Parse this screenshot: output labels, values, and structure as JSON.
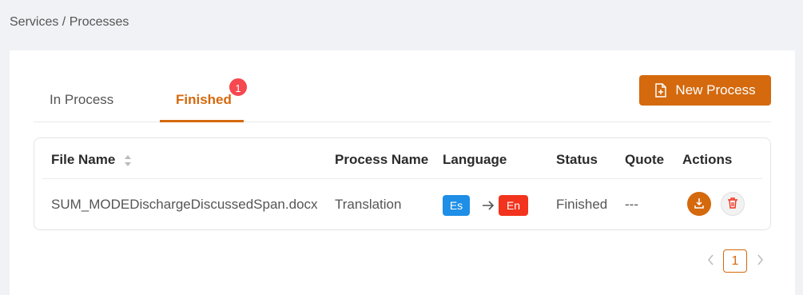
{
  "breadcrumb": "Services / Processes",
  "tabs": [
    {
      "label": "In Process",
      "active": false
    },
    {
      "label": "Finished",
      "active": true,
      "badge": "1"
    }
  ],
  "new_process_label": "New Process",
  "table": {
    "columns": [
      "File Name",
      "Process Name",
      "Language",
      "Status",
      "Quote",
      "Actions"
    ],
    "rows": [
      {
        "file_name": "SUM_MODEDischargeDiscussedSpan.docx",
        "process_name": "Translation",
        "source_lang": "Es",
        "target_lang": "En",
        "status": "Finished",
        "quote": "---"
      }
    ]
  },
  "pagination": {
    "current": "1"
  },
  "colors": {
    "accent": "#d4690d",
    "badge": "#f5484f",
    "source_lang": "#1e8ee6",
    "target_lang": "#f2331d"
  },
  "icons": [
    "file-plus-icon",
    "sort-icon",
    "arrow-right-icon",
    "download-icon",
    "trash-icon",
    "chevron-left-icon",
    "chevron-right-icon"
  ]
}
